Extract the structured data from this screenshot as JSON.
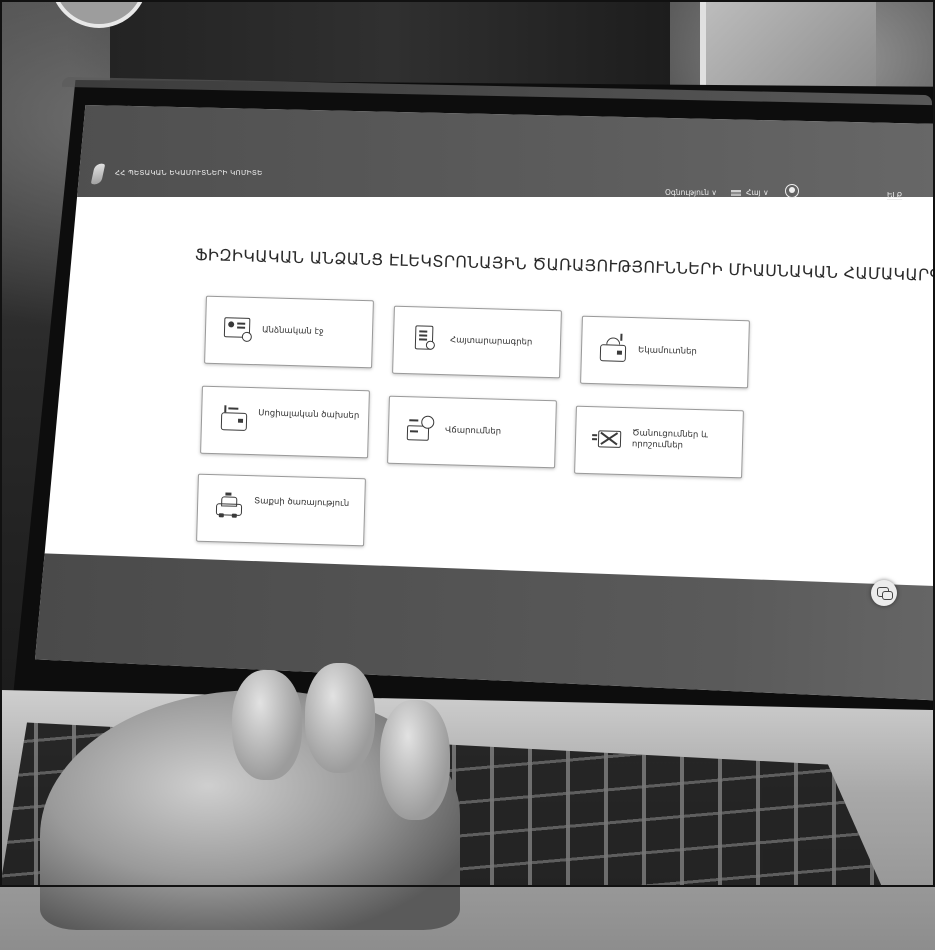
{
  "header": {
    "brand_name": "ՀՀ ՊԵՏԱԿԱՆ ԵԿԱՄՈՒՏՆԵՐԻ ԿՈՄԻՏԵ",
    "help_label": "Օգնություն ∨",
    "language_label": "Հայ",
    "language_caret": "∨",
    "logout_label": "ԵԼՔ"
  },
  "main": {
    "title": "ՖԻԶԻԿԱԿԱՆ ԱՆՁԱՆՑ ԷԼԵԿՏՐՈՆԱՅԻՆ ԾԱՌԱՅՈՒԹՅՈՒՆՆԵՐԻ ՄԻԱՍՆԱԿԱՆ ՀԱՄԱԿԱՐԳ",
    "tiles": [
      {
        "label": "Անձնական էջ",
        "icon": "personal-page-icon"
      },
      {
        "label": "Հայտարարագրեր",
        "icon": "declarations-icon"
      },
      {
        "label": "Եկամուտներ",
        "icon": "incomes-icon"
      },
      {
        "label": "Սոցիալական ծախսեր",
        "icon": "social-expenses-icon"
      },
      {
        "label": "Վճարումներ",
        "icon": "payments-icon"
      },
      {
        "label": "Ծանուցումներ և որոշումներ",
        "icon": "notifications-icon"
      },
      {
        "label": "Տաքսի ծառայություն",
        "icon": "taxi-icon"
      }
    ]
  },
  "chat": {
    "icon": "chat-icon"
  }
}
